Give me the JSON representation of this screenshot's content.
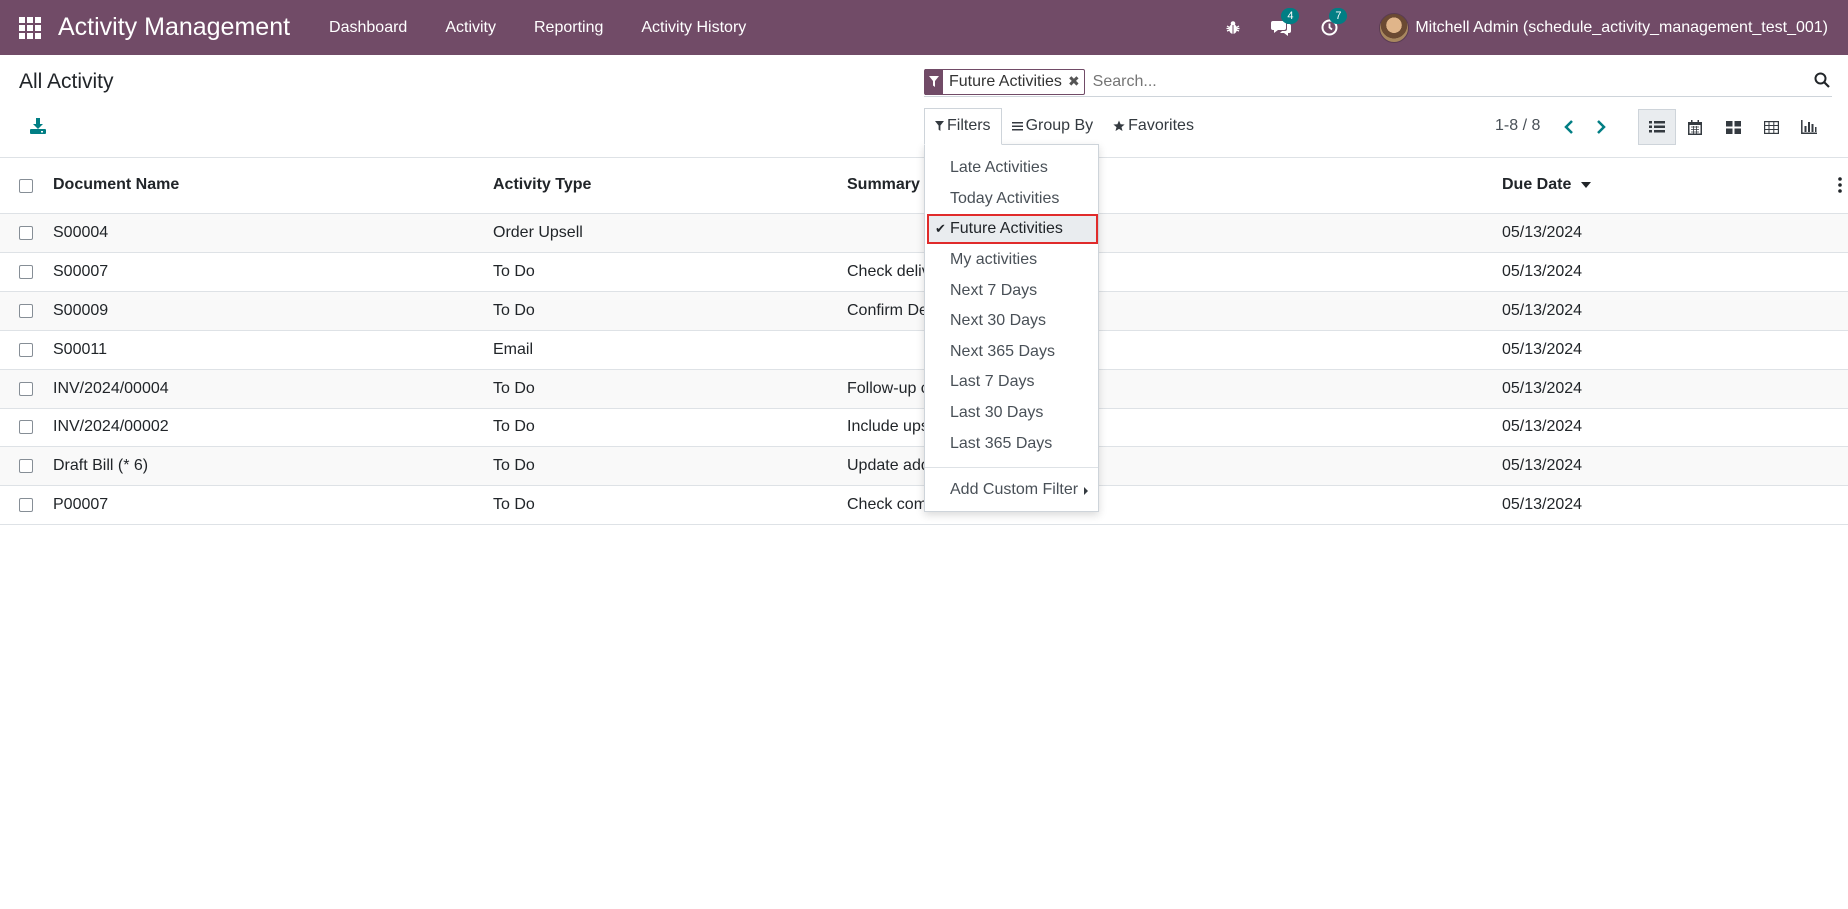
{
  "navbar": {
    "app_title": "Activity Management",
    "menu": [
      "Dashboard",
      "Activity",
      "Reporting",
      "Activity History"
    ],
    "messages_badge": "4",
    "activities_badge": "7",
    "user": "Mitchell Admin (schedule_activity_management_test_001)",
    "bg_color": "#714B67"
  },
  "control_panel": {
    "title": "All Activity",
    "facet_label": "Future Activities",
    "search_placeholder": "Search...",
    "filters_label": "Filters",
    "group_by_label": "Group By",
    "favorites_label": "Favorites",
    "pager": "1-8 / 8",
    "views": [
      "list-icon",
      "calendar-icon",
      "kanban-icon",
      "pivot-icon",
      "graph-icon"
    ],
    "active_view": "list-icon"
  },
  "table": {
    "columns": [
      "Document Name",
      "Activity Type",
      "Summary",
      "Due Date"
    ],
    "sort_column": "Due Date",
    "rows": [
      {
        "document": "S00004",
        "type": "Order Upsell",
        "summary": "",
        "due": "05/13/2024"
      },
      {
        "document": "S00007",
        "type": "To Do",
        "summary": "Check deliv",
        "due": "05/13/2024"
      },
      {
        "document": "S00009",
        "type": "To Do",
        "summary": "Confirm De",
        "due": "05/13/2024"
      },
      {
        "document": "S00011",
        "type": "Email",
        "summary": "",
        "due": "05/13/2024"
      },
      {
        "document": "INV/2024/00004",
        "type": "To Do",
        "summary": "Follow-up c",
        "due": "05/13/2024"
      },
      {
        "document": "INV/2024/00002",
        "type": "To Do",
        "summary": "Include ups",
        "due": "05/13/2024"
      },
      {
        "document": "Draft Bill (* 6)",
        "type": "To Do",
        "summary": "Update add",
        "due": "05/13/2024"
      },
      {
        "document": "P00007",
        "type": "To Do",
        "summary": "Check com",
        "due": "05/13/2024"
      }
    ]
  },
  "filters_dropdown": {
    "items": [
      {
        "label": "Late Activities",
        "checked": false
      },
      {
        "label": "Today Activities",
        "checked": false
      },
      {
        "label": "Future Activities",
        "checked": true
      },
      {
        "label": "My activities",
        "checked": false
      },
      {
        "label": "Next 7 Days",
        "checked": false
      },
      {
        "label": "Next 30 Days",
        "checked": false
      },
      {
        "label": "Next 365 Days",
        "checked": false
      },
      {
        "label": "Last 7 Days",
        "checked": false
      },
      {
        "label": "Last 30 Days",
        "checked": false
      },
      {
        "label": "Last 365 Days",
        "checked": false
      }
    ],
    "custom_filter_label": "Add Custom Filter",
    "check_glyph": "✔"
  }
}
